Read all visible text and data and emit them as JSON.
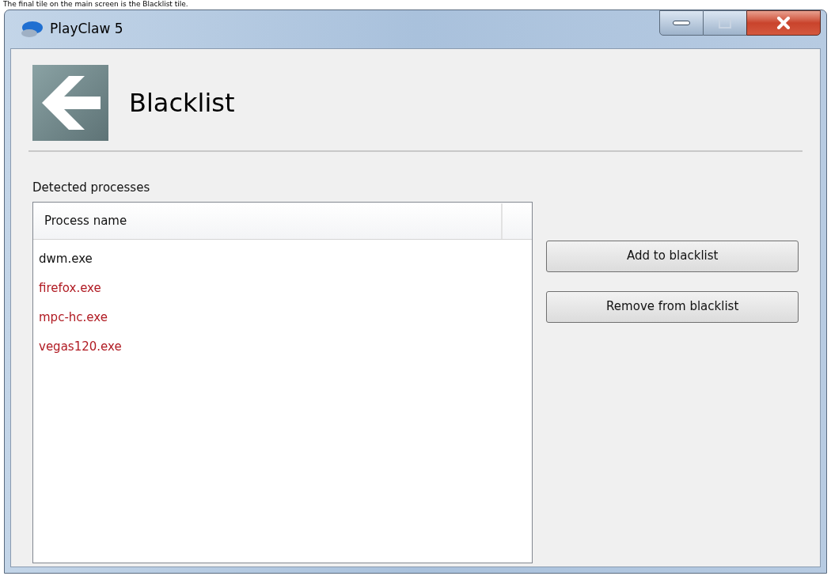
{
  "caption": "The final tile on the main screen is the Blacklist tile.",
  "window": {
    "title": "PlayClaw 5"
  },
  "page": {
    "title": "Blacklist"
  },
  "list": {
    "label": "Detected processes",
    "columns": [
      "Process name"
    ],
    "rows": [
      {
        "name": "dwm.exe",
        "blacklisted": false
      },
      {
        "name": "firefox.exe",
        "blacklisted": true
      },
      {
        "name": "mpc-hc.exe",
        "blacklisted": true
      },
      {
        "name": "vegas120.exe",
        "blacklisted": true
      }
    ]
  },
  "buttons": [
    "Add to blacklist",
    "Remove from blacklist"
  ]
}
